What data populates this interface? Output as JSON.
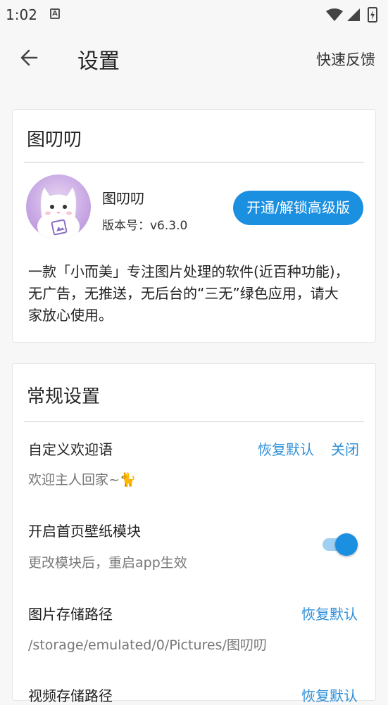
{
  "status_bar": {
    "time": "1:02",
    "notification_icon": "A"
  },
  "app_bar": {
    "title": "设置",
    "feedback_label": "快速反馈"
  },
  "about_card": {
    "header": "图叨叨",
    "app_name": "图叨叨",
    "version": "版本号：v6.3.0",
    "unlock_label": "开通/解锁高级版",
    "description": "一款「小而美」专注图片处理的软件(近百种功能)，无广告，无推送，无后台的“三无”绿色应用，请大家放心使用。"
  },
  "general_card": {
    "header": "常规设置",
    "welcome": {
      "title": "自定义欢迎语",
      "value": "欢迎主人回家~🐈",
      "restore_label": "恢复默认",
      "close_label": "关闭"
    },
    "wallpaper": {
      "title": "开启首页壁纸模块",
      "subtitle": "更改模块后，重启app生效",
      "enabled": true
    },
    "image_path": {
      "title": "图片存储路径",
      "value": "/storage/emulated/0/Pictures/图叨叨",
      "restore_label": "恢复默认"
    },
    "video_path": {
      "title": "视频存储路径",
      "restore_label": "恢复默认"
    }
  }
}
